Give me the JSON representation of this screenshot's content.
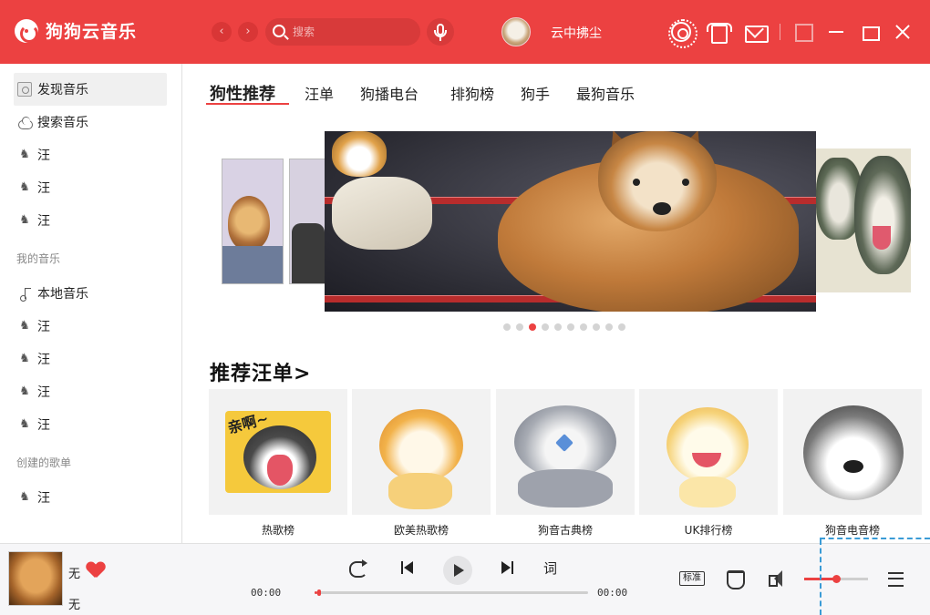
{
  "app": {
    "name": "狗狗云音乐",
    "brand_color": "#ec4141"
  },
  "header": {
    "search_placeholder": "搜索",
    "username": "云中拂尘",
    "icons": [
      "back-icon",
      "forward-icon",
      "search-icon",
      "mic-icon",
      "gear-icon",
      "shirt-icon",
      "mail-icon",
      "mini-mode-icon",
      "minimize-icon",
      "maximize-icon",
      "close-icon"
    ]
  },
  "sidebar": {
    "top_items": [
      {
        "label": "发现音乐",
        "icon": "discover-icon",
        "active": true
      },
      {
        "label": "搜索音乐",
        "icon": "cloud-icon"
      },
      {
        "label": "汪",
        "icon": "dog-icon"
      },
      {
        "label": "汪",
        "icon": "dog-icon"
      },
      {
        "label": "汪",
        "icon": "dog-icon"
      }
    ],
    "section_my": "我的音乐",
    "my_items": [
      {
        "label": "本地音乐",
        "icon": "music-note-icon"
      },
      {
        "label": "汪",
        "icon": "dog-icon"
      },
      {
        "label": "汪",
        "icon": "dog-icon"
      },
      {
        "label": "汪",
        "icon": "dog-icon"
      },
      {
        "label": "汪",
        "icon": "dog-icon"
      }
    ],
    "section_created": "创建的歌单",
    "created_items": [
      {
        "label": "汪",
        "icon": "dog-icon"
      }
    ]
  },
  "main": {
    "tabs": [
      {
        "label": "狗性推荐",
        "active": true
      },
      {
        "label": "汪单"
      },
      {
        "label": "狗播电台"
      },
      {
        "label": "排狗榜"
      },
      {
        "label": "狗手"
      },
      {
        "label": "最狗音乐"
      }
    ],
    "carousel": {
      "dot_count": 10,
      "active_dot": 3
    },
    "section_title": "推荐汪单>",
    "cards": [
      {
        "label": "热歌榜",
        "art_text": "亲啊~"
      },
      {
        "label": "欧美热歌榜"
      },
      {
        "label": "狗音古典榜"
      },
      {
        "label": "UK排行榜"
      },
      {
        "label": "狗音电音榜"
      }
    ]
  },
  "player": {
    "song_title": "无",
    "artist": "无",
    "liked": true,
    "current_time": "00:00",
    "total_time": "00:00",
    "progress_fraction": 0.01,
    "lyric_label": "词",
    "quality_label": "标准",
    "volume_fraction": 0.5
  }
}
